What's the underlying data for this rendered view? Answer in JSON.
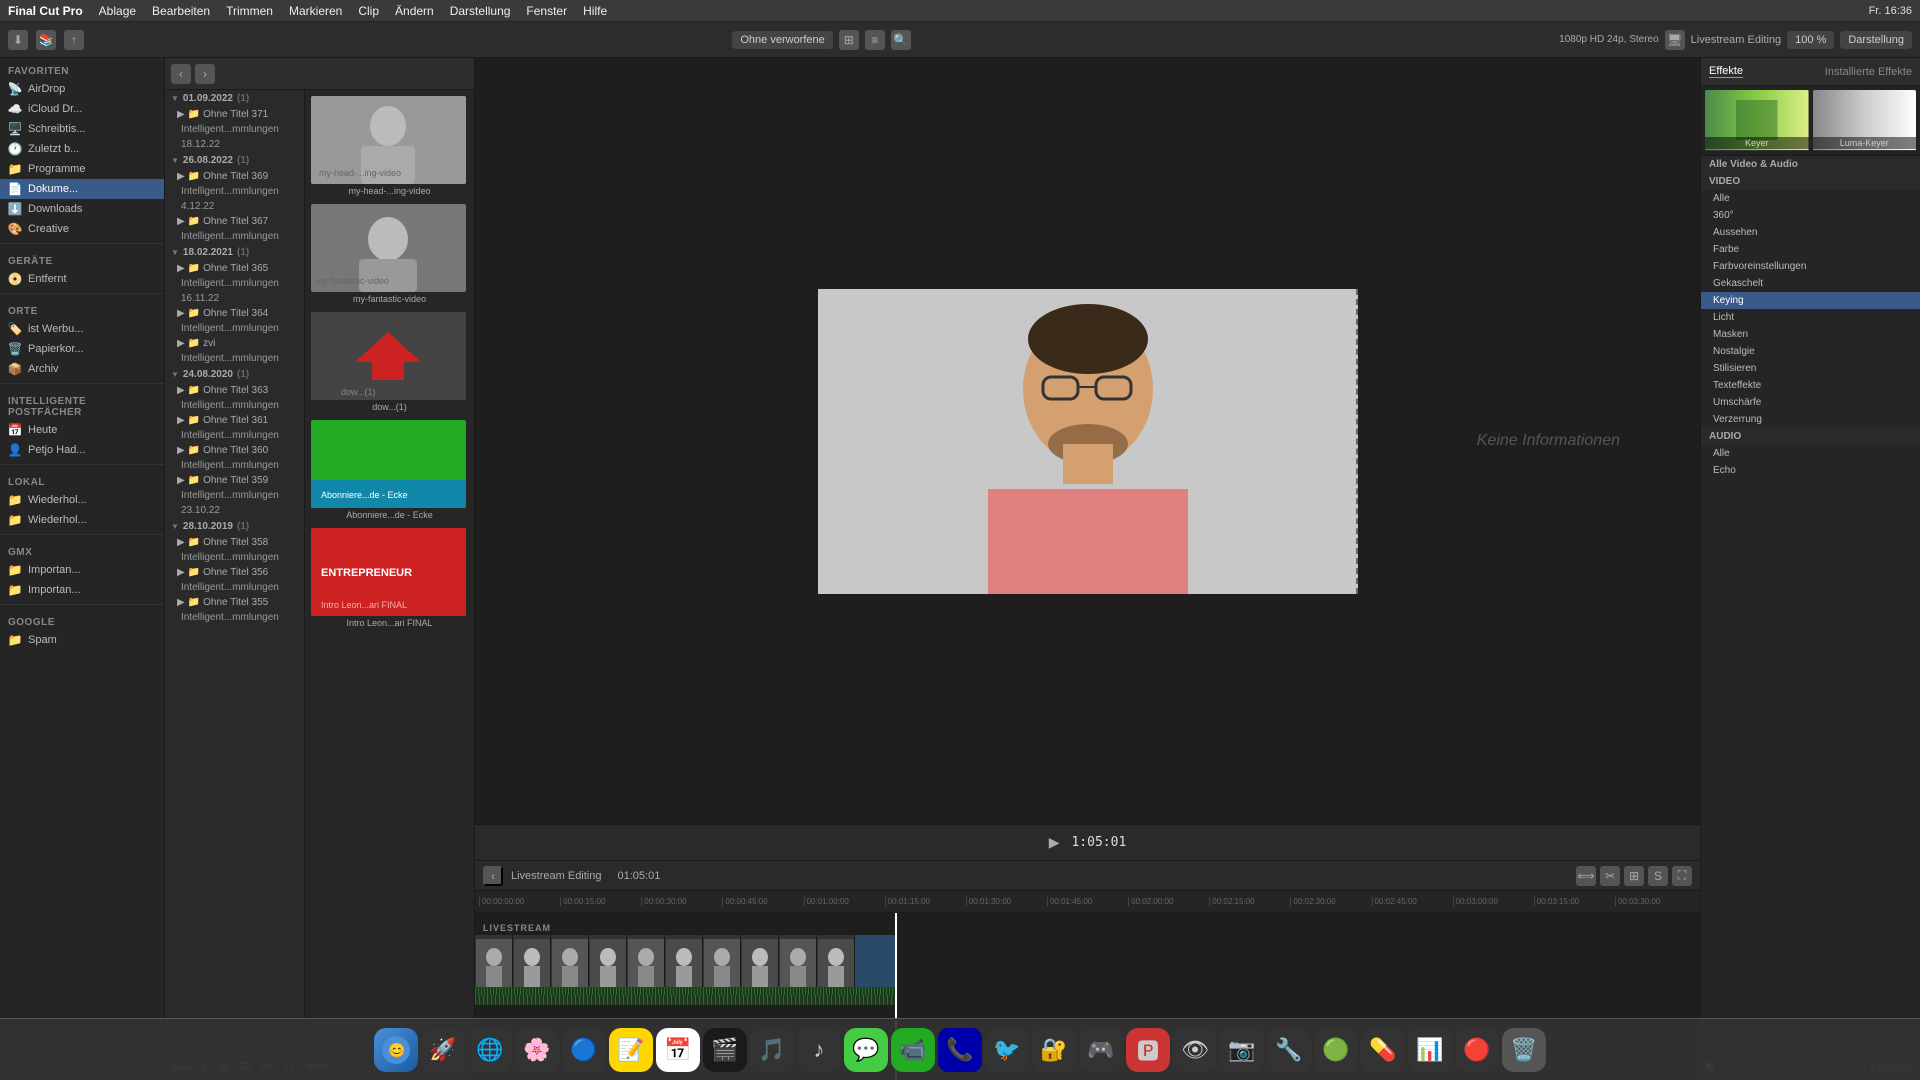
{
  "app": {
    "name": "Final Cut Pro X",
    "menu_items": [
      "Final Cut Pro",
      "Ablage",
      "Bearbeiten",
      "Trimmen",
      "Markieren",
      "Clip",
      "Ändern",
      "Darstellung",
      "Fenster",
      "Hilfe"
    ],
    "time": "Fr. 16:36",
    "zoom": "100 %",
    "layout": "Darstellung",
    "format": "1080p HD 24p, Stereo",
    "filter": "Ohne verworfene",
    "project_name": "Livestream Editing",
    "timecode": "1:05:01"
  },
  "sidebar": {
    "favorites_label": "Favoriten",
    "items": [
      {
        "label": "AirDrop",
        "icon": "📡"
      },
      {
        "label": "iCloud Dr...",
        "icon": "☁️"
      },
      {
        "label": "Schreibtis...",
        "icon": "🖥️"
      },
      {
        "label": "Zuletzt b...",
        "icon": "🕐"
      },
      {
        "label": "Programme",
        "icon": "📁"
      },
      {
        "label": "Dokume...",
        "icon": "📄"
      },
      {
        "label": "Downloads",
        "icon": "⬇️"
      },
      {
        "label": "Creative",
        "icon": "🎨"
      }
    ],
    "devices_label": "Geräte",
    "devices": [
      {
        "label": "Entfernt",
        "icon": "📀"
      }
    ],
    "tags_label": "Orte",
    "tags": [
      {
        "label": "ist Werbu...",
        "icon": "🏷️"
      },
      {
        "label": "Papierkor...",
        "icon": "🗑️"
      },
      {
        "label": "Archiv",
        "icon": "📦"
      }
    ],
    "intelligent_label": "Intelligente Postfächer",
    "intelligent": [
      {
        "label": "Heute",
        "icon": "📅"
      },
      {
        "label": "Petjo Had...",
        "icon": "👤"
      }
    ],
    "local_label": "Lokal",
    "local": [
      {
        "label": "Wiederhol...",
        "icon": "📁"
      },
      {
        "label": "Wiederhol...",
        "icon": "📁"
      }
    ],
    "gmx_label": "Gmx",
    "gmx": [
      {
        "label": "Importan...",
        "icon": "📁"
      },
      {
        "label": "Importan...",
        "icon": "📁"
      }
    ],
    "google_label": "Google",
    "google": [
      {
        "label": "Spam",
        "icon": "📁"
      }
    ]
  },
  "browser": {
    "dates": [
      {
        "date": "01.09.2022",
        "count": "(1)",
        "items": [
          {
            "label": "Ohne Titel 371"
          },
          {
            "label": "Intelligent...mmlungen"
          },
          {
            "label": "18.12.22"
          }
        ],
        "thumb": "my-head-...ing-video",
        "thumb_type": "video"
      },
      {
        "date": "26.08.2022",
        "count": "(1)",
        "items": [
          {
            "label": "Ohne Titel 369"
          },
          {
            "label": "Intelligent...mmlungen"
          },
          {
            "label": "4.12.22"
          },
          {
            "label": "Ohne Titel 367"
          },
          {
            "label": "Intelligent...mmlungen"
          }
        ],
        "thumb": "my-fantastic-video",
        "thumb_type": "video"
      },
      {
        "date": "18.02.2021",
        "count": "(1)",
        "items": [
          {
            "label": "Ohne Titel 365"
          },
          {
            "label": "Intelligent...mmlungen"
          },
          {
            "label": "16.11.22"
          },
          {
            "label": "Ohne Titel 364"
          },
          {
            "label": "Intelligent...mmlungen"
          },
          {
            "label": "zvi"
          },
          {
            "label": "Intelligent...mmlungen"
          }
        ],
        "thumb": "dow...(1)",
        "thumb_type": "download"
      },
      {
        "date": "24.08.2020",
        "count": "(1)",
        "items": [
          {
            "label": "Ohne Titel 363"
          },
          {
            "label": "Intelligent...mmlungen"
          },
          {
            "label": "Ohne Titel 361"
          },
          {
            "label": "Intelligent...mmlungen"
          },
          {
            "label": "Ohne Titel 360"
          },
          {
            "label": "Intelligent...mmlungen"
          },
          {
            "label": "Ohne Titel 359"
          },
          {
            "label": "Intelligent...mmlungen"
          },
          {
            "label": "23.10.22"
          }
        ],
        "thumb": "Abonniere...de - Ecke",
        "thumb_type": "green"
      },
      {
        "date": "28.10.2019",
        "count": "(1)",
        "items": [
          {
            "label": "Ohne Titel 358"
          },
          {
            "label": "Intelligent...mmlungen"
          },
          {
            "label": "Ohne Titel 356"
          },
          {
            "label": "Intelligent...mmlungen"
          },
          {
            "label": "Ohne Titel 355"
          },
          {
            "label": "Intelligent...mmlungen"
          }
        ],
        "thumb": "Intro Leon...ari FINAL",
        "thumb_type": "red"
      }
    ],
    "object_count": "34 Objekte"
  },
  "viewer": {
    "no_info": "Keine Informationen",
    "timecode": "1:05:01"
  },
  "effects": {
    "header_active": "Effekte",
    "header_inactive": "Installierte Effekte",
    "categories": [
      {
        "label": "Alle Video & Audio",
        "type": "header"
      },
      {
        "label": "VIDEO",
        "type": "header"
      },
      {
        "label": "Alle",
        "type": "item"
      },
      {
        "label": "360°",
        "type": "item"
      },
      {
        "label": "Aussehen",
        "type": "item"
      },
      {
        "label": "Farbe",
        "type": "item"
      },
      {
        "label": "Farbvoreinstellungen",
        "type": "item"
      },
      {
        "label": "Gekaschelt",
        "type": "item"
      },
      {
        "label": "Keying",
        "type": "item",
        "selected": true
      },
      {
        "label": "Licht",
        "type": "item"
      },
      {
        "label": "Masken",
        "type": "item"
      },
      {
        "label": "Nostalgie",
        "type": "item"
      },
      {
        "label": "Stilisieren",
        "type": "item"
      },
      {
        "label": "Texteffekte",
        "type": "item"
      },
      {
        "label": "Umschärfe",
        "type": "item"
      },
      {
        "label": "Verzerrung",
        "type": "item"
      },
      {
        "label": "AUDIO",
        "type": "header"
      },
      {
        "label": "Alle",
        "type": "item"
      },
      {
        "label": "Echo",
        "type": "item"
      }
    ],
    "previews": [
      {
        "label": "Keyer",
        "type": "landscape"
      },
      {
        "label": "Luma-Keyer",
        "type": "landscape"
      }
    ],
    "count": "2 Objekte",
    "search_placeholder": ""
  },
  "timeline": {
    "name": "Livestream Editing",
    "timecode": "01:05:01",
    "ruler_marks": [
      "00:00:00:00",
      "00:00:15:00",
      "00:00:30:00",
      "00:00:45:00",
      "00:01:00:00",
      "00:01:15:00",
      "00:01:30:00",
      "00:01:45:00",
      "00:02:00:00",
      "00:02:15:00",
      "00:02:30:00",
      "00:02:45:00",
      "00:03:00:00",
      "00:03:15:00",
      "00:03:30:00"
    ],
    "track_label": "LIVESTREAM"
  },
  "dock": {
    "items": [
      {
        "icon": "🔍",
        "label": "Finder"
      },
      {
        "icon": "🚀",
        "label": "Launchpad"
      },
      {
        "icon": "🌐",
        "label": "Safari"
      },
      {
        "icon": "📝",
        "label": "Notes"
      },
      {
        "icon": "📅",
        "label": "Calendar"
      },
      {
        "icon": "🖼️",
        "label": "Photos"
      },
      {
        "icon": "🎬",
        "label": "Final Cut"
      },
      {
        "icon": "🎵",
        "label": "Music"
      },
      {
        "icon": "📊",
        "label": "Numbers"
      },
      {
        "icon": "💬",
        "label": "Messages"
      },
      {
        "icon": "📷",
        "label": "Camera"
      },
      {
        "icon": "🎮",
        "label": "Games"
      }
    ]
  }
}
